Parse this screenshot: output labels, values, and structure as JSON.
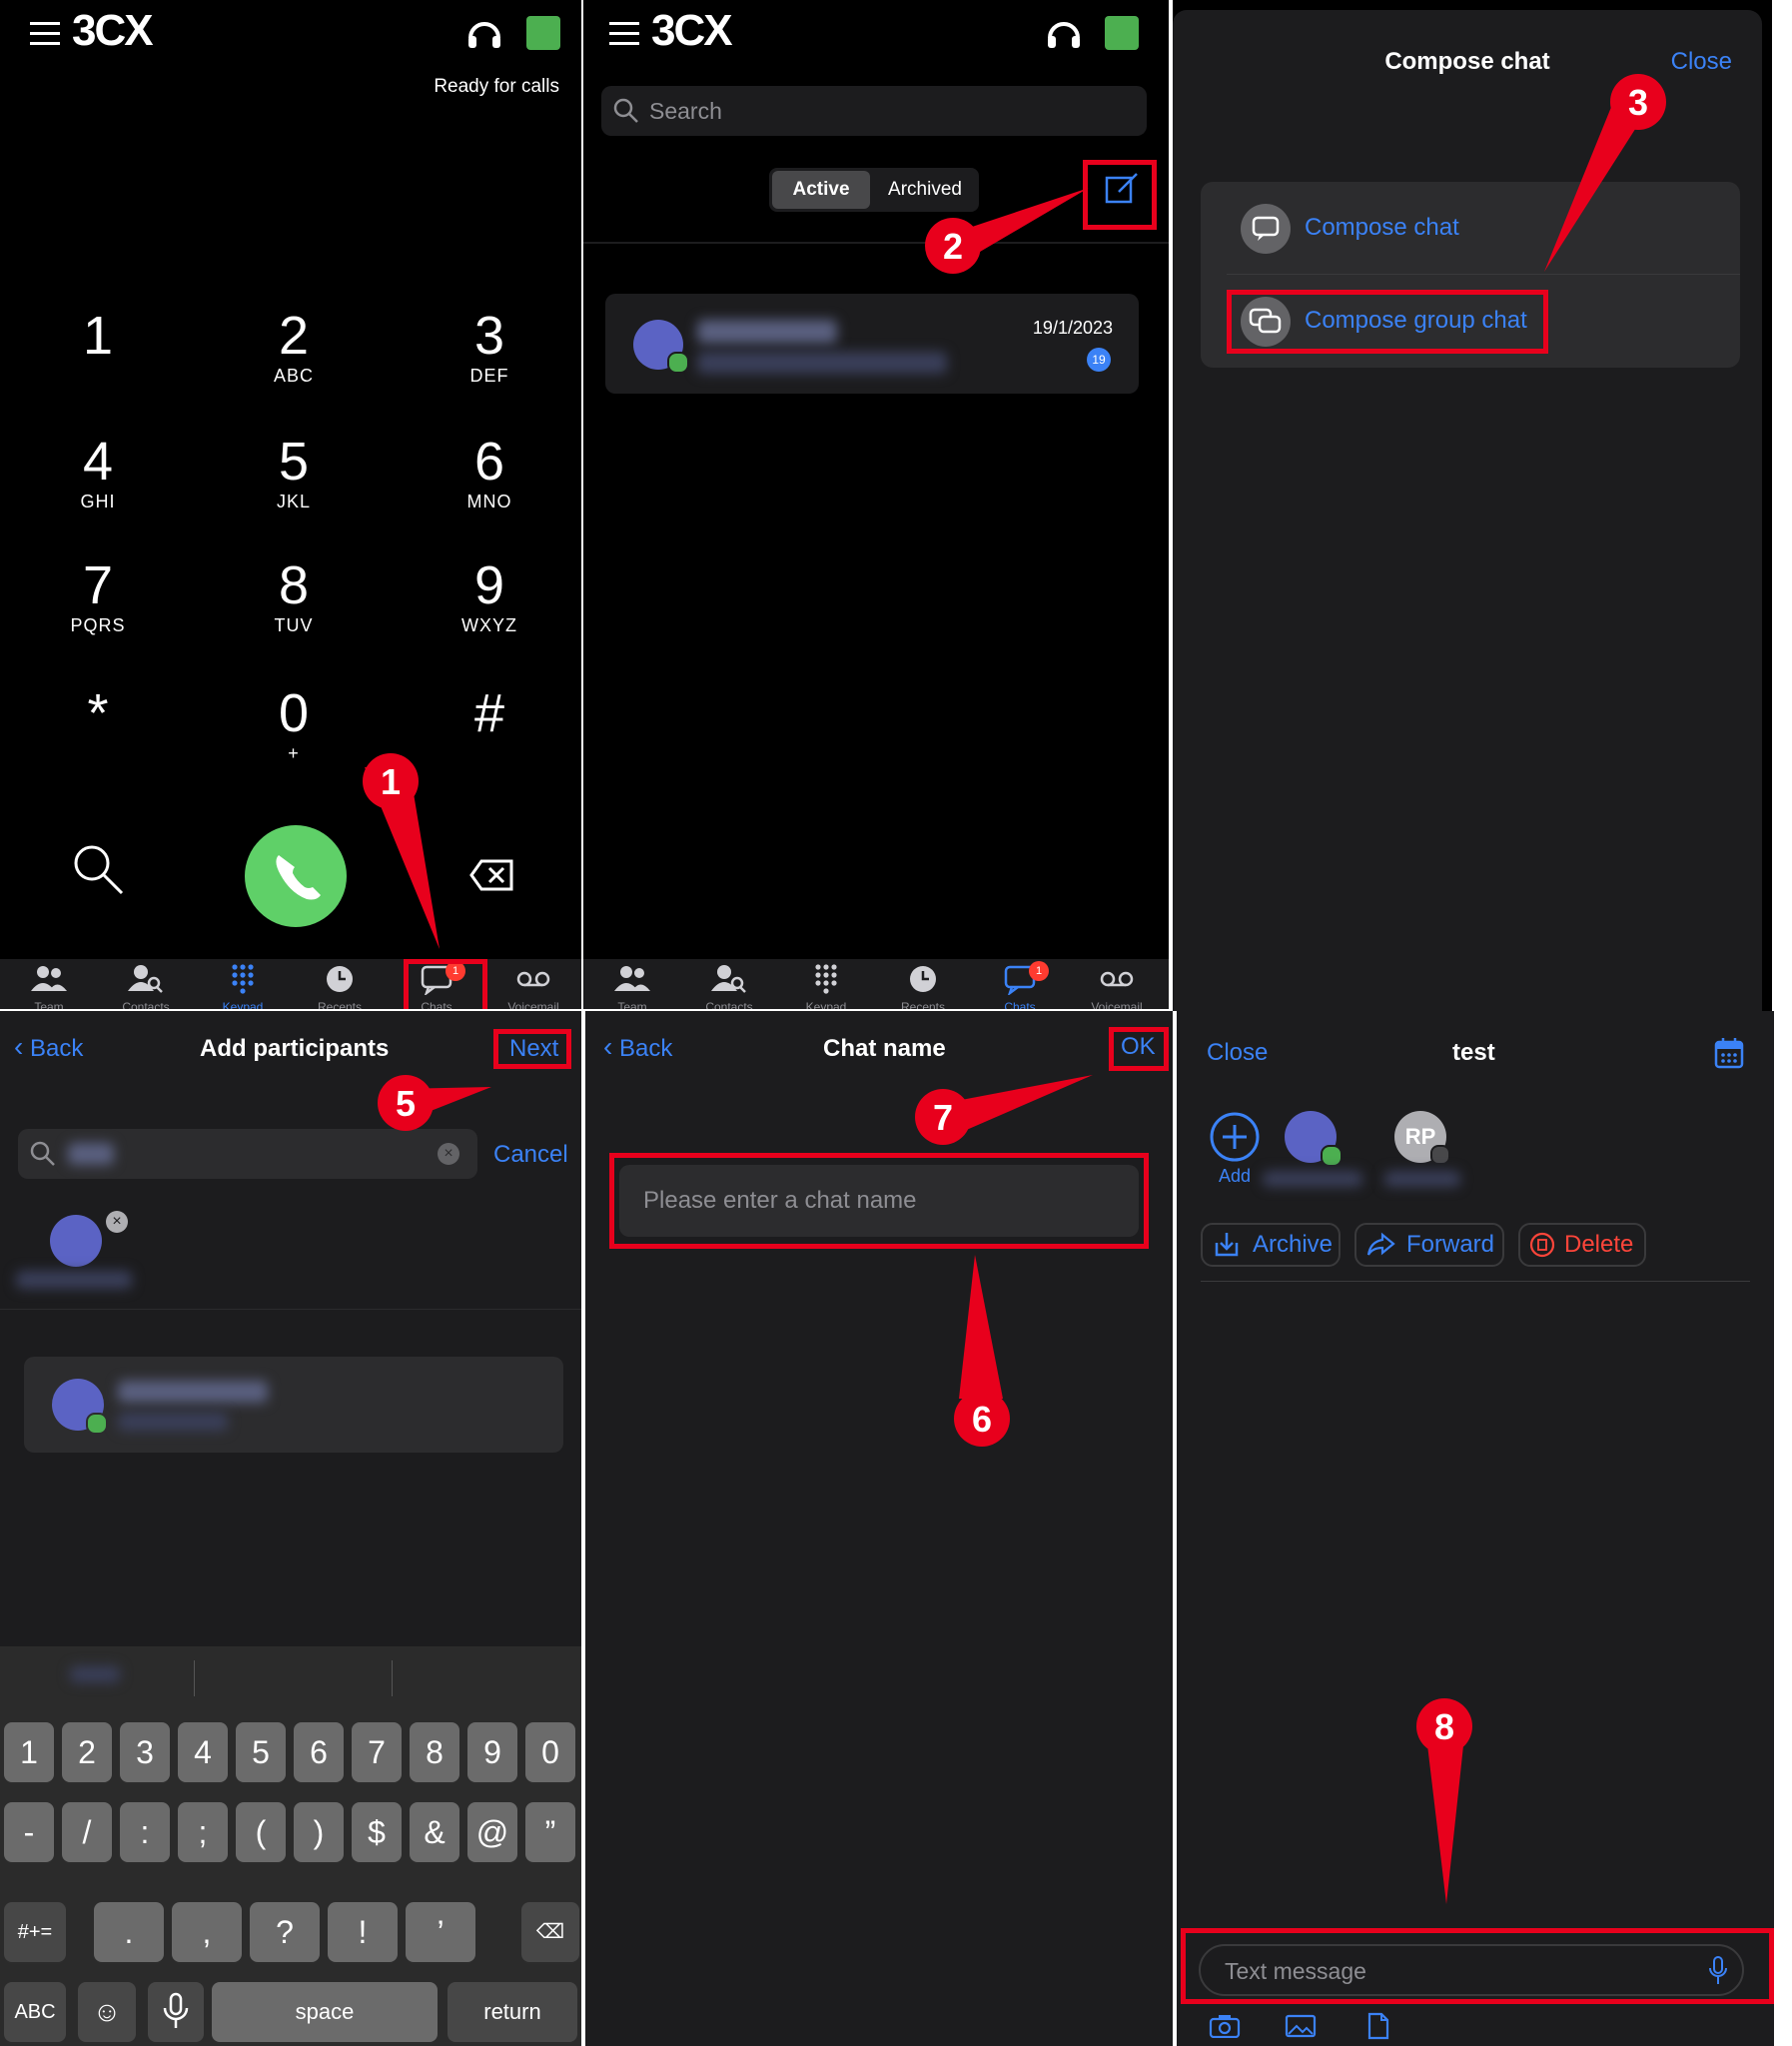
{
  "dialer": {
    "status": "Ready for calls",
    "keys": [
      {
        "d": "1",
        "l": ""
      },
      {
        "d": "2",
        "l": "ABC"
      },
      {
        "d": "3",
        "l": "DEF"
      },
      {
        "d": "4",
        "l": "GHI"
      },
      {
        "d": "5",
        "l": "JKL"
      },
      {
        "d": "6",
        "l": "MNO"
      },
      {
        "d": "7",
        "l": "PQRS"
      },
      {
        "d": "8",
        "l": "TUV"
      },
      {
        "d": "9",
        "l": "WXYZ"
      },
      {
        "d": "*",
        "l": ""
      },
      {
        "d": "0",
        "l": "+"
      },
      {
        "d": "#",
        "l": ""
      }
    ]
  },
  "brand": "3CX",
  "tabs": [
    "Team",
    "Contacts",
    "Keypad",
    "Recents",
    "Chats",
    "Voicemail"
  ],
  "badge": "1",
  "chats": {
    "search_placeholder": "Search",
    "seg_active": "Active",
    "seg_archived": "Archived",
    "item_date": "19/1/2023",
    "item_badge": "19"
  },
  "compose": {
    "title": "Compose chat",
    "close": "Close",
    "option1": "Compose chat",
    "option2": "Compose group chat"
  },
  "participants": {
    "back": "Back",
    "title": "Add participants",
    "next": "Next",
    "cancel": "Cancel"
  },
  "keyboard": {
    "row1": [
      "1",
      "2",
      "3",
      "4",
      "5",
      "6",
      "7",
      "8",
      "9",
      "0"
    ],
    "row2": [
      "-",
      "/",
      ":",
      ";",
      "(",
      ")",
      "$",
      "&",
      "@",
      "”"
    ],
    "row3": [
      ".",
      ",",
      "?",
      "!",
      "’"
    ],
    "sym": "#+=",
    "abc": "ABC",
    "space": "space",
    "return": "return"
  },
  "chatname": {
    "back": "Back",
    "title": "Chat name",
    "ok": "OK",
    "placeholder": "Please enter a chat name"
  },
  "group": {
    "close": "Close",
    "title": "test",
    "add": "Add",
    "initials": "RP",
    "archive": "Archive",
    "forward": "Forward",
    "delete": "Delete",
    "message_placeholder": "Text message"
  },
  "callouts": [
    "1",
    "2",
    "3",
    "5",
    "7",
    "6",
    "8"
  ],
  "colors": {
    "accent": "#3b82f6",
    "callout": "#e8001c",
    "call_green": "#5fd068",
    "status_green": "#4caf50",
    "delete_red": "#ff453a"
  }
}
